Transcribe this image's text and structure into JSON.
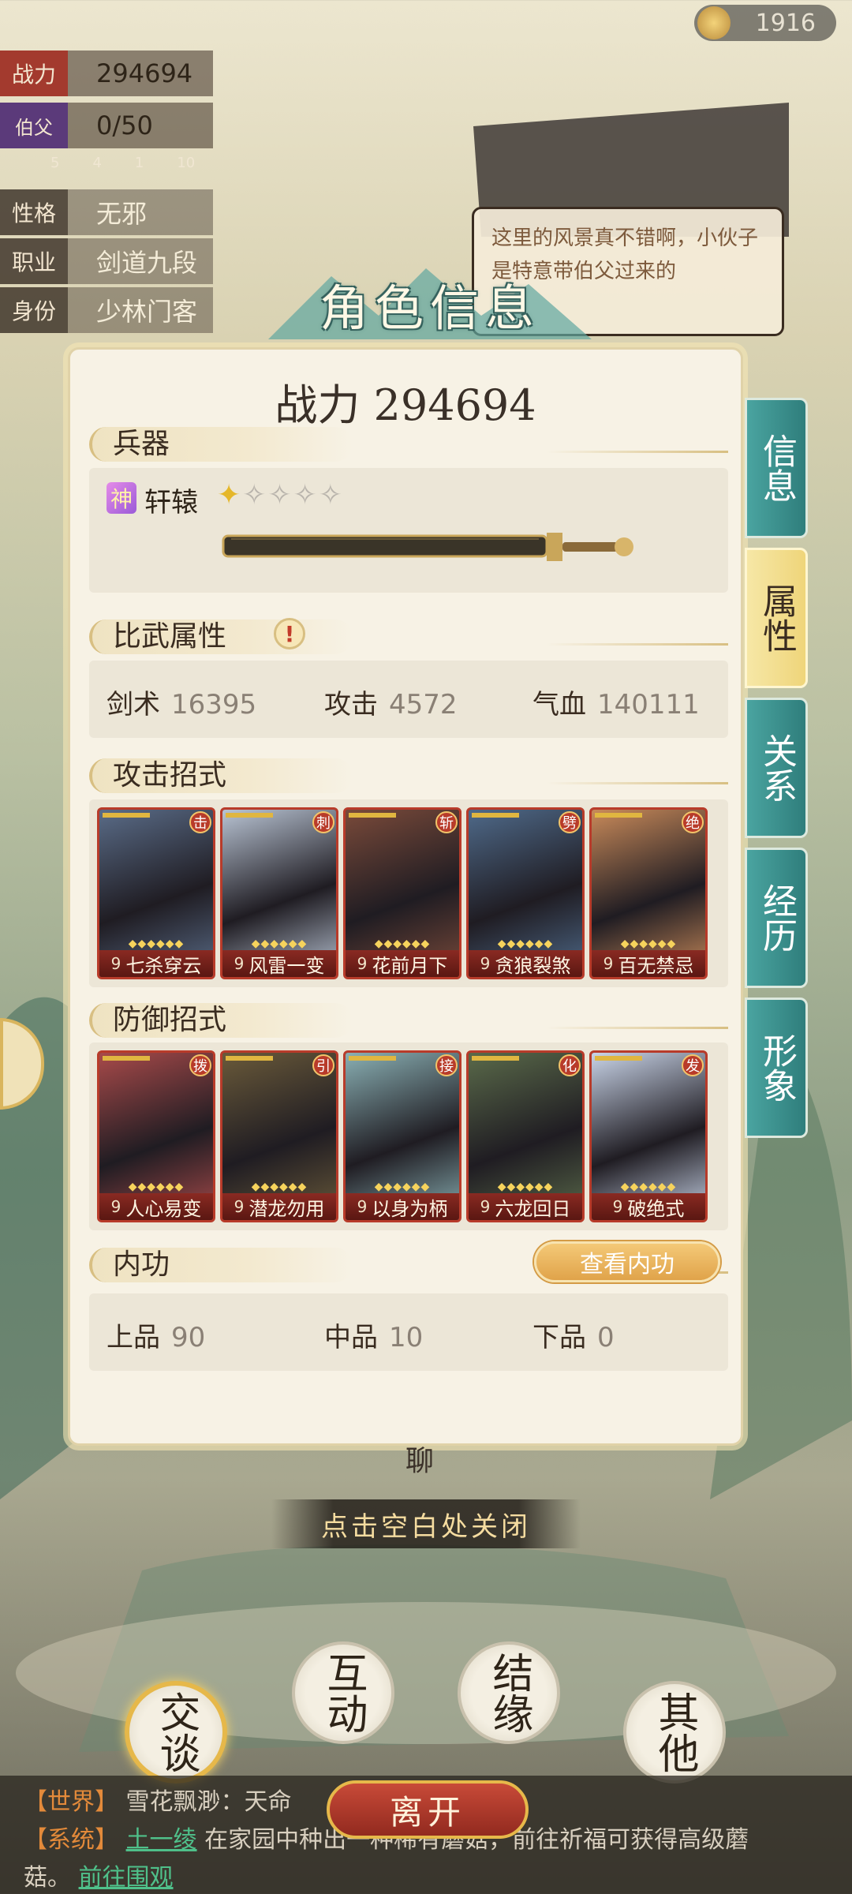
{
  "coins": {
    "value": "1916",
    "icon": "tea-cup-icon"
  },
  "profile": {
    "rows": [
      {
        "tag": "战力",
        "value": "294694"
      },
      {
        "tag": "伯父",
        "value": "0/50"
      },
      {
        "tag": "性格",
        "value": "无邪"
      },
      {
        "tag": "职业",
        "value": "剑道九段"
      },
      {
        "tag": "身份",
        "value": "少林门客"
      }
    ],
    "gifts": [
      "5",
      "4",
      "1",
      "10"
    ]
  },
  "speech": "这里的风景真不错啊，小伙子是特意带伯父过来的",
  "dialog": {
    "title": "角色信息",
    "power_label": "战力 294694",
    "weapon": {
      "section": "兵器",
      "badge": "神",
      "name": "轩辕",
      "stars_on": 1,
      "stars_total": 5
    },
    "stats": {
      "section": "比武属性",
      "alert": "!",
      "items": [
        {
          "label": "剑术",
          "value": "16395"
        },
        {
          "label": "攻击",
          "value": "4572"
        },
        {
          "label": "气血",
          "value": "140111"
        }
      ]
    },
    "attack": {
      "section": "攻击招式",
      "cards": [
        {
          "type": "击",
          "level": "9",
          "name": "七杀穿云",
          "art": "#5a6c88"
        },
        {
          "type": "刺",
          "level": "9",
          "name": "风雷一变",
          "art": "#b9c4d4"
        },
        {
          "type": "斩",
          "level": "9",
          "name": "花前月下",
          "art": "#7a4a3a"
        },
        {
          "type": "劈",
          "level": "9",
          "name": "贪狼裂煞",
          "art": "#4f6a8a"
        },
        {
          "type": "绝",
          "level": "9",
          "name": "百无禁忌",
          "art": "#c98a5a"
        }
      ]
    },
    "defense": {
      "section": "防御招式",
      "cards": [
        {
          "type": "拨",
          "level": "9",
          "name": "人心易变",
          "art": "#a84a4a"
        },
        {
          "type": "引",
          "level": "9",
          "name": "潜龙勿用",
          "art": "#6a5a3a"
        },
        {
          "type": "接",
          "level": "9",
          "name": "以身为柄",
          "art": "#8ab0b4"
        },
        {
          "type": "化",
          "level": "9",
          "name": "六龙回日",
          "art": "#5a6a4a"
        },
        {
          "type": "发",
          "level": "9",
          "name": "破绝式",
          "art": "#c9d4e8"
        }
      ]
    },
    "neigong": {
      "section": "内功",
      "button": "查看内功",
      "items": [
        {
          "label": "上品",
          "value": "90"
        },
        {
          "label": "中品",
          "value": "10"
        },
        {
          "label": "下品",
          "value": "0"
        }
      ]
    }
  },
  "tabs": [
    {
      "label": "信息",
      "active": false
    },
    {
      "label": "属性",
      "active": true
    },
    {
      "label": "关系",
      "active": false
    },
    {
      "label": "经历",
      "active": false
    },
    {
      "label": "形象",
      "active": false
    }
  ],
  "close_hint": "点击空白处关闭",
  "behind_label": "聊",
  "actions": [
    "交谈",
    "互动",
    "结缘",
    "其他"
  ],
  "leave": "离开",
  "chat": {
    "line1_tag": "【世界】",
    "line1_text": "雪花飘渺：天命",
    "line2_tag": "【系统】",
    "line2_name": "土一绫",
    "line2_text": "在家园中种出一种稀有蘑菇，前往祈福可获得高级蘑",
    "line3_text": "菇。",
    "line3_link": "前往围观"
  }
}
